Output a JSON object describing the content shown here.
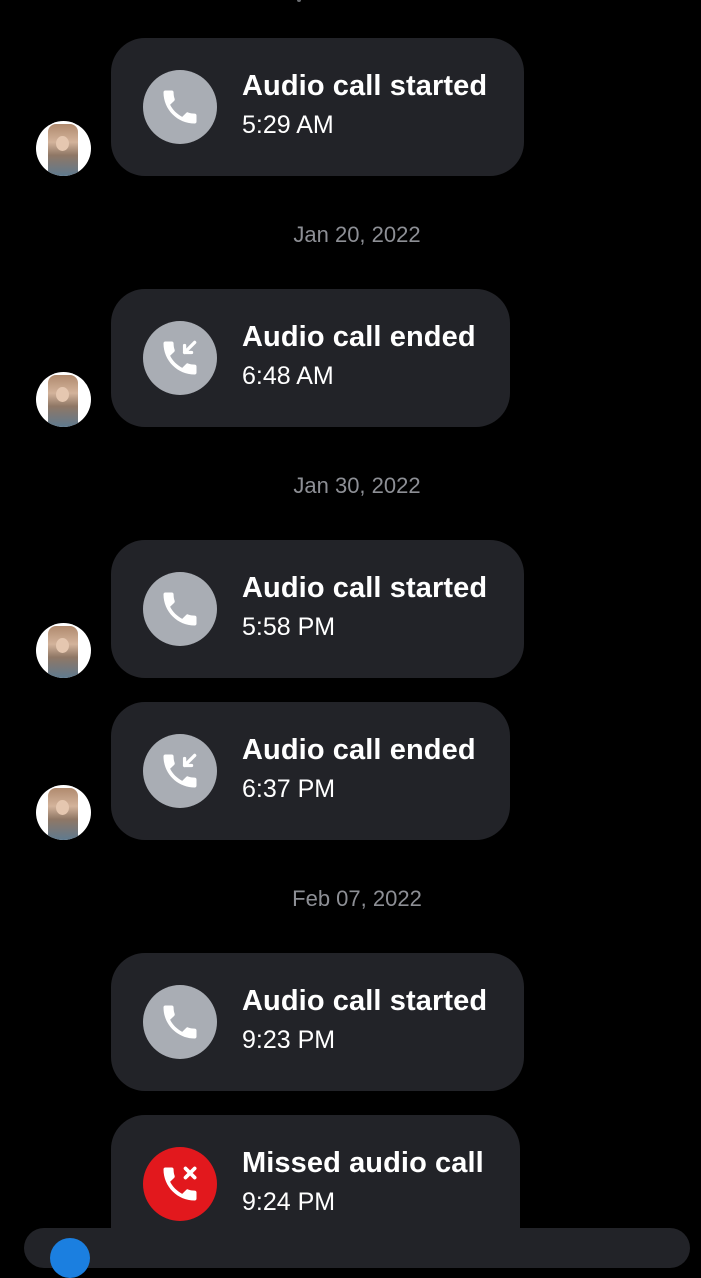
{
  "messages": [
    {
      "title": "Audio call started",
      "time": "5:29 AM",
      "icon": "phone-icon",
      "type": "started"
    },
    {
      "title": "Audio call ended",
      "time": "6:48 AM",
      "icon": "phone-incoming-icon",
      "type": "ended"
    },
    {
      "title": "Audio call started",
      "time": "5:58 PM",
      "icon": "phone-icon",
      "type": "started"
    },
    {
      "title": "Audio call ended",
      "time": "6:37 PM",
      "icon": "phone-incoming-icon",
      "type": "ended"
    },
    {
      "title": "Audio call started",
      "time": "9:23 PM",
      "icon": "phone-icon",
      "type": "started"
    },
    {
      "title": "Missed audio call",
      "time": "9:24 PM",
      "icon": "phone-missed-icon",
      "type": "missed"
    }
  ],
  "date_separators": [
    "Jan 20, 2022",
    "Jan 30, 2022",
    "Feb 07, 2022"
  ],
  "colors": {
    "background": "#000000",
    "bubble": "#222328",
    "icon_gray": "#a9adb4",
    "missed_red": "#e2181d",
    "date_text": "#8d8f95",
    "composer_accent": "#1b7fe0"
  }
}
